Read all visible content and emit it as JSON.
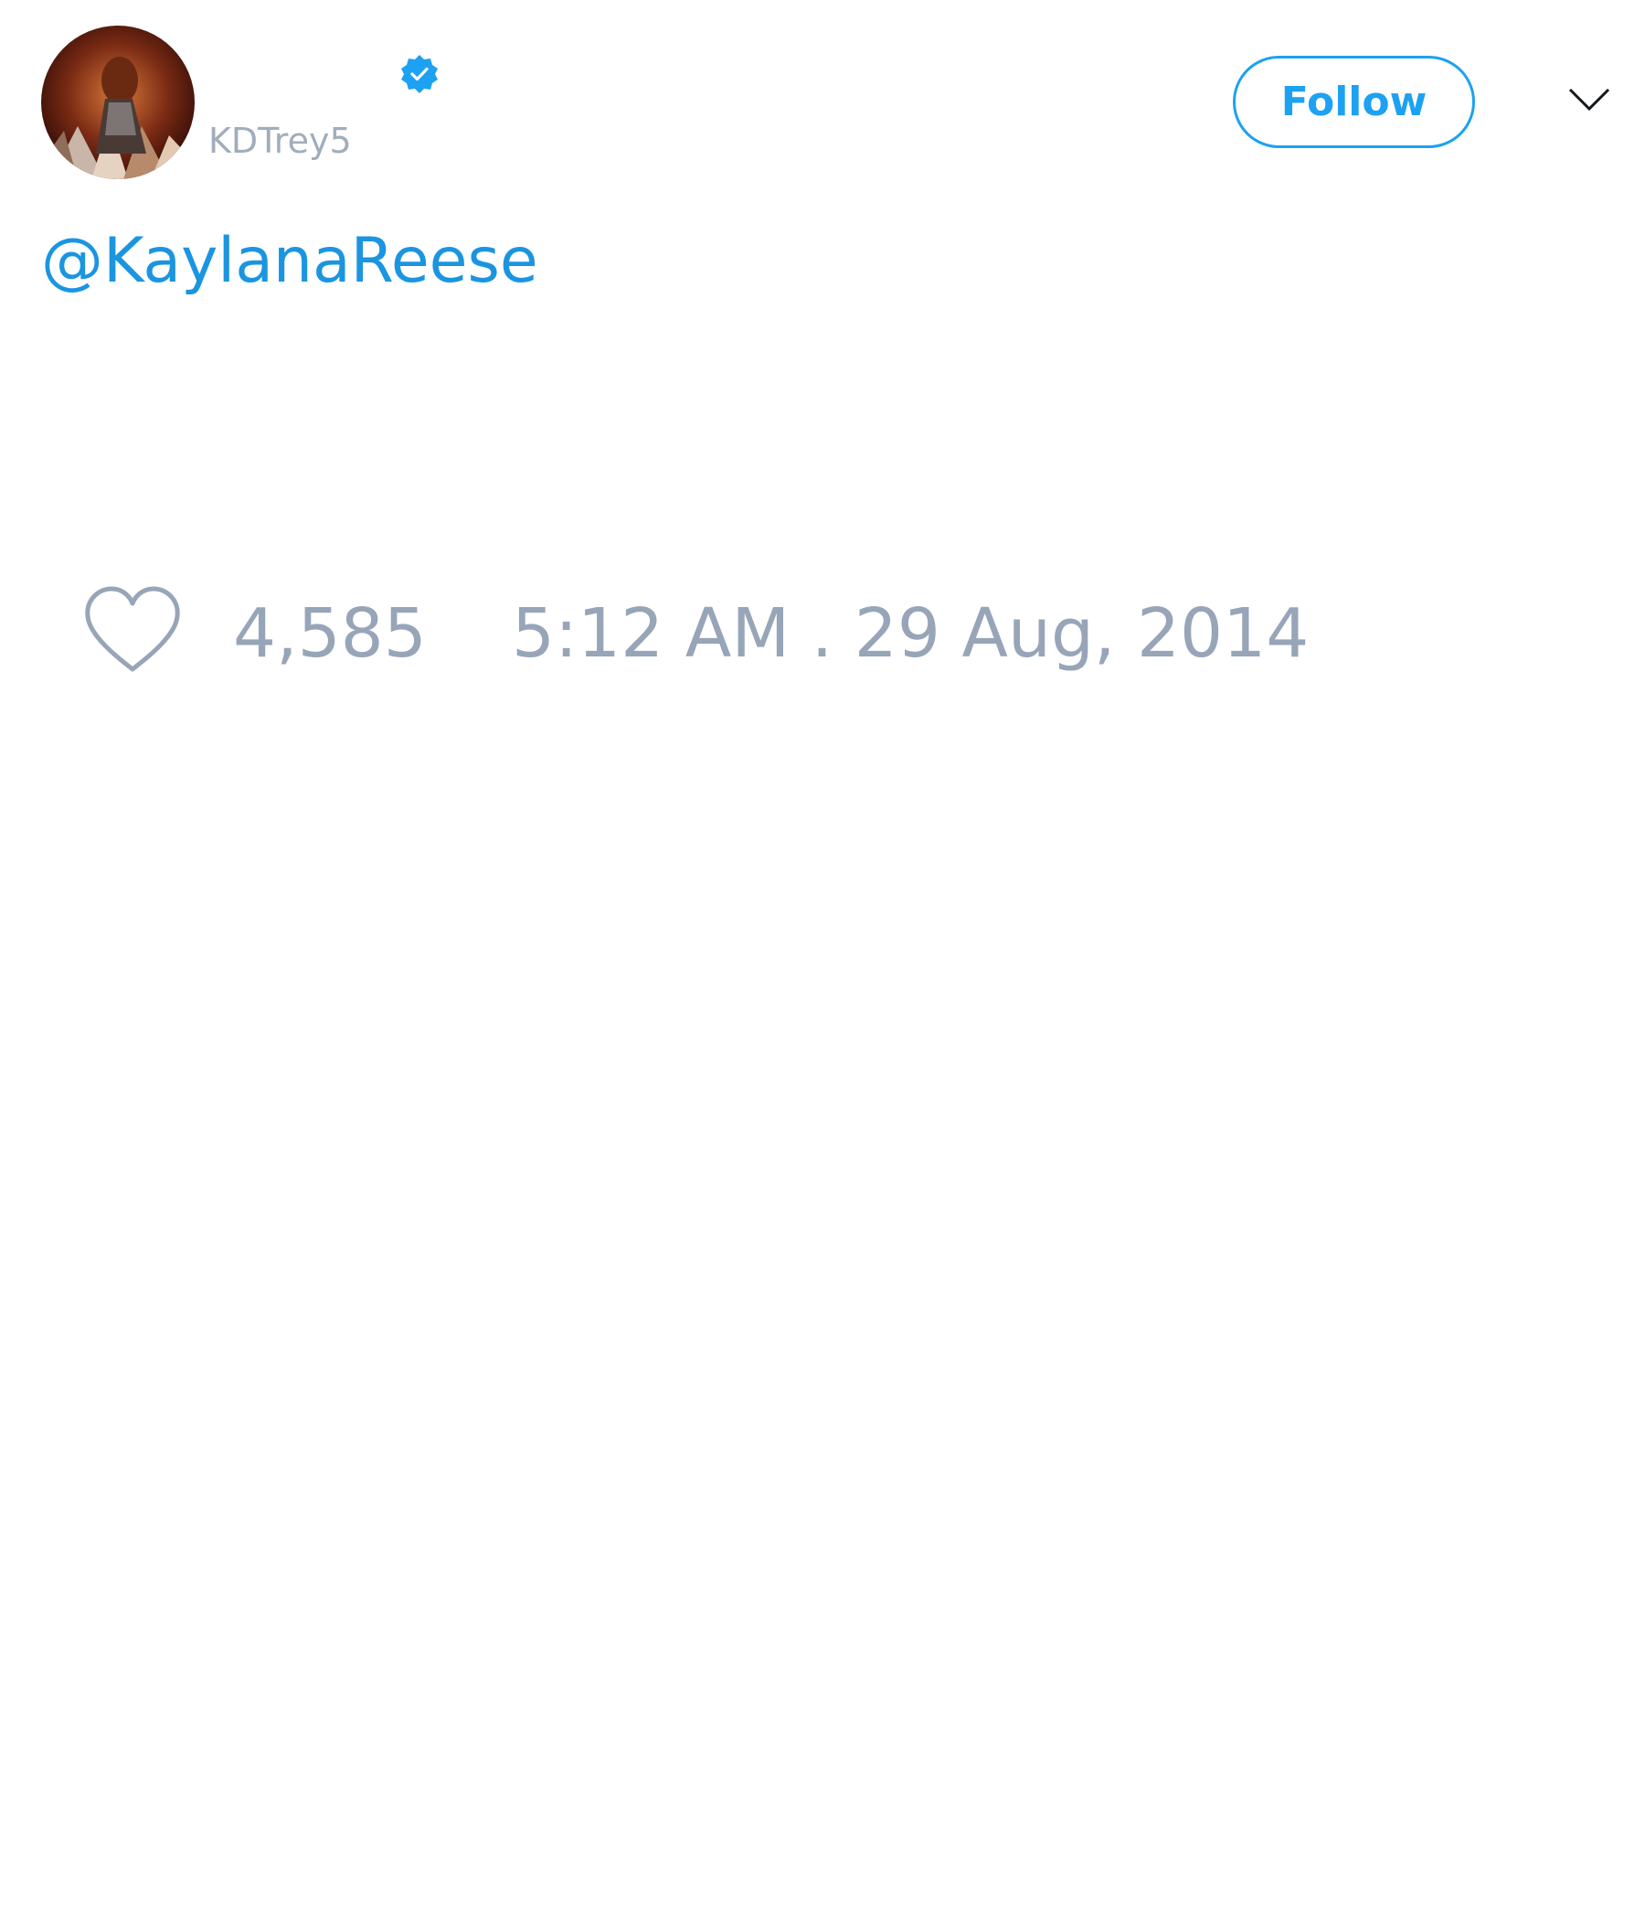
{
  "user": {
    "display_name": "",
    "handle": "KDTrey5",
    "verified": true,
    "verified_icon": "verified-badge-icon"
  },
  "header": {
    "follow_label": "Follow",
    "menu_icon": "chevron-down-icon"
  },
  "tweet": {
    "text": "@KaylanaReese"
  },
  "stats": {
    "like_icon": "heart-icon",
    "likes": "4,585",
    "timestamp": "5:12 AM . 29 Aug, 2014"
  },
  "colors": {
    "accent": "#1da1f2",
    "mention": "#1b95e0",
    "muted": "#97a5b8"
  }
}
